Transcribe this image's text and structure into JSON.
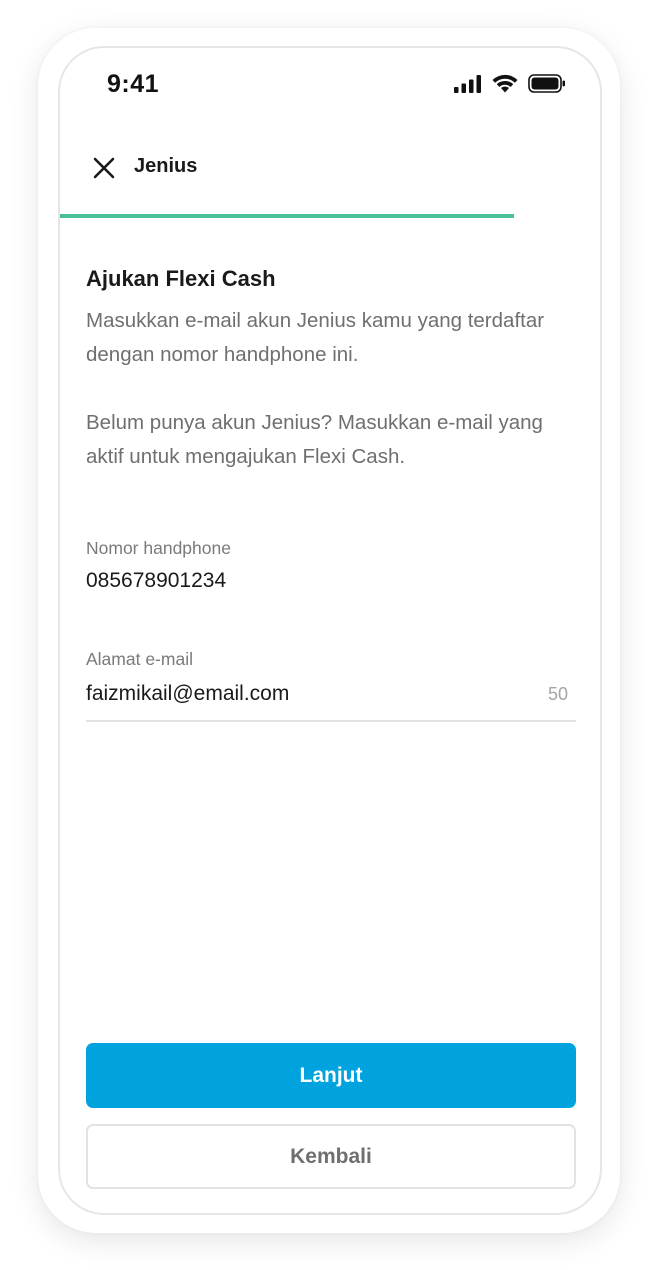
{
  "status_bar": {
    "time": "9:41",
    "icons": [
      "signal-icon",
      "wifi-icon",
      "battery-icon"
    ]
  },
  "header": {
    "title": "Jenius",
    "close_icon": "close-icon"
  },
  "progress": {
    "value": 0.84,
    "color": "#4cbf95"
  },
  "main": {
    "title": "Ajukan Flexi Cash",
    "description_1": "Masukkan e-mail akun Jenius kamu yang terdaftar dengan nomor handphone ini.",
    "description_2": "Belum punya akun Jenius? Masukkan e-mail yang aktif untuk mengajukan Flexi Cash."
  },
  "form": {
    "phone_label": "Nomor handphone",
    "phone_value": "085678901234",
    "email_label": "Alamat e-mail",
    "email_value": "faizmikail@email.com",
    "email_max_length": "50"
  },
  "actions": {
    "primary_label": "Lanjut",
    "primary_color": "#00a3de",
    "secondary_label": "Kembali"
  }
}
